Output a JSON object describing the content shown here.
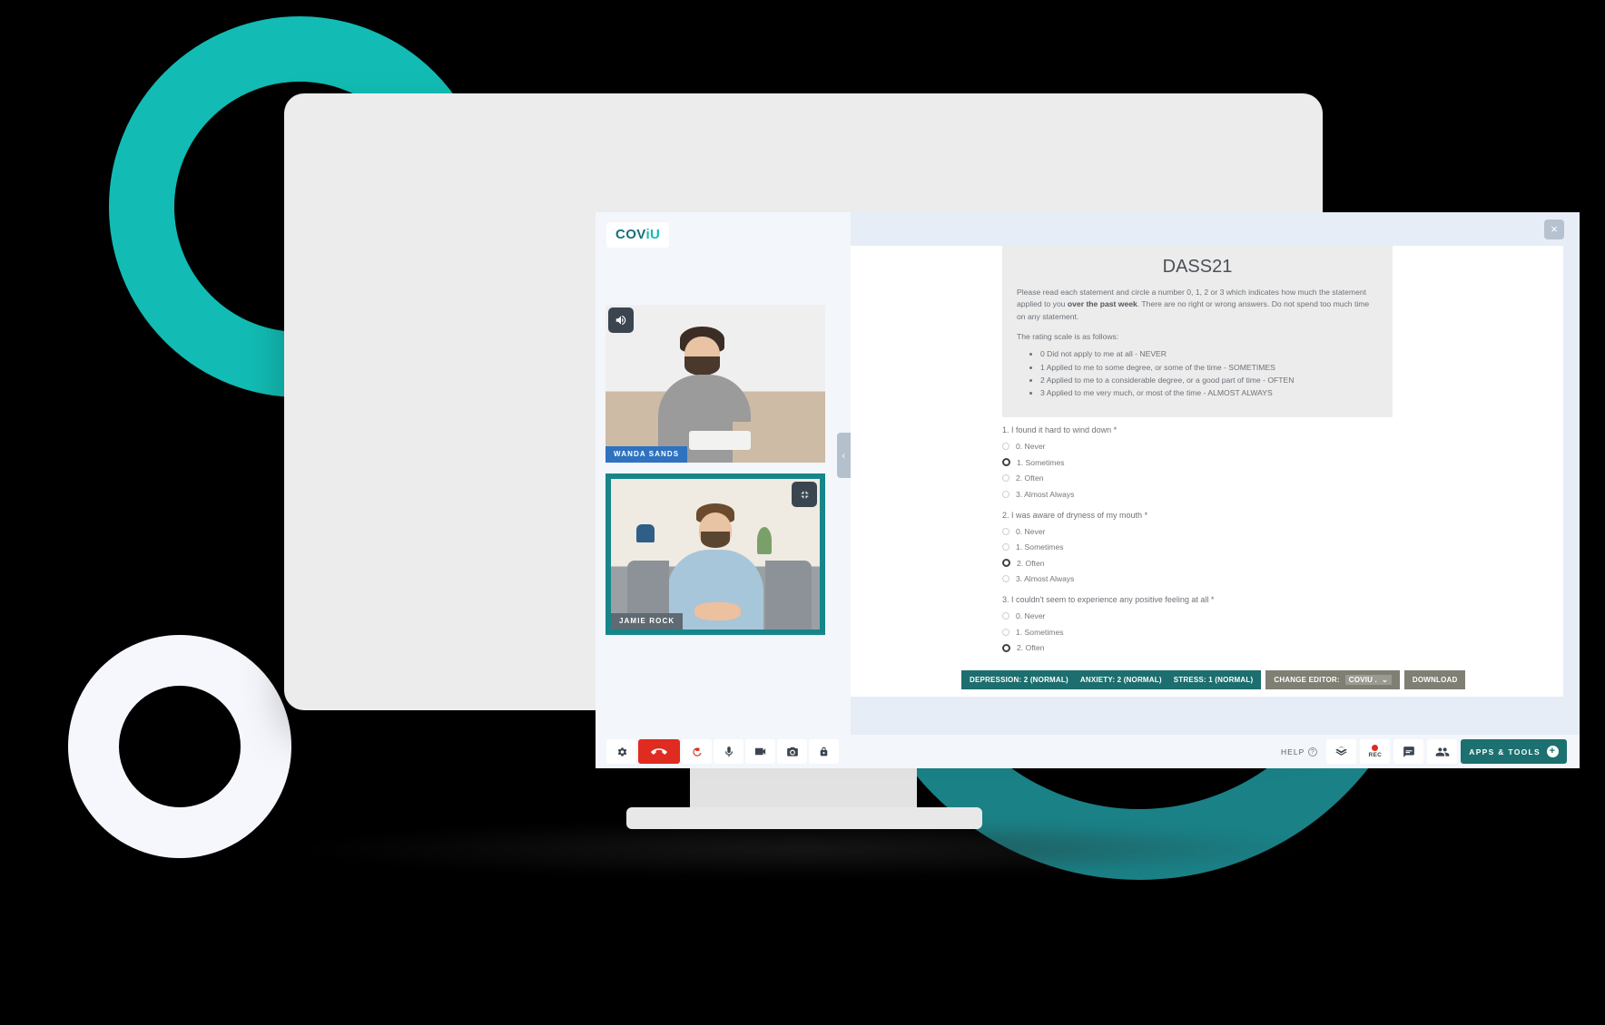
{
  "brand": {
    "logo_part_a": "COV",
    "logo_part_b": "iU",
    "accent_teal": "#1d7070",
    "accent_light_teal": "#12bcb4",
    "accent_dark_teal": "#1a8186",
    "danger_red": "#e02b20"
  },
  "video": {
    "tiles": [
      {
        "name": "WANDA SANDS",
        "icon": "speaker-icon"
      },
      {
        "name": "JAMIE ROCK",
        "icon": "shrink-icon"
      }
    ],
    "collapse_left": "‹",
    "collapse_right": "›"
  },
  "panel": {
    "close_label": "×"
  },
  "form": {
    "title": "DASS21",
    "intro_part1": "Please read each statement and circle a number 0, 1, 2 or 3 which indicates how much the statement applied to you ",
    "intro_bold": "over the past week",
    "intro_part2": ". There are no right or wrong answers. Do not spend too much time on any statement.",
    "scale_header": "The rating scale is as follows:",
    "scale_items": [
      "0 Did not apply to me at all - NEVER",
      "1 Applied to me to some degree, or some of the time - SOMETIMES",
      "2 Applied to me to a considerable degree, or a good part of time - OFTEN",
      "3 Applied to me very much, or most of the time - ALMOST ALWAYS"
    ],
    "questions": [
      {
        "text": "1. I found it hard to wind down *",
        "options": [
          "0. Never",
          "1. Sometimes",
          "2. Often",
          "3. Almost Always"
        ],
        "selected": 1
      },
      {
        "text": "2. I was aware of dryness of my mouth *",
        "options": [
          "0. Never",
          "1. Sometimes",
          "2. Often",
          "3. Almost Always"
        ],
        "selected": 2
      },
      {
        "text": "3. I couldn't seem to experience any positive feeling at all *",
        "options": [
          "0. Never",
          "1. Sometimes",
          "2. Often"
        ],
        "selected": 2
      }
    ]
  },
  "results": {
    "depression": "DEPRESSION: 2 (NORMAL)",
    "anxiety": "ANXIETY: 2 (NORMAL)",
    "stress": "STRESS: 1 (NORMAL)",
    "change_editor_label": "CHANGE EDITOR:",
    "change_editor_value": "COVIU .",
    "change_editor_caret": "⌄",
    "download_label": "DOWNLOAD"
  },
  "controls": {
    "left": [
      {
        "name": "settings-button",
        "icon": "gear-icon"
      },
      {
        "name": "hangup-button",
        "icon": "phone-hangup-icon"
      },
      {
        "name": "refresh-button",
        "icon": "refresh-icon"
      },
      {
        "name": "microphone-button",
        "icon": "microphone-icon"
      },
      {
        "name": "camera-button",
        "icon": "video-camera-icon"
      },
      {
        "name": "snapshot-button",
        "icon": "photo-camera-icon"
      },
      {
        "name": "lock-button",
        "icon": "lock-icon"
      }
    ],
    "help_label": "HELP",
    "help_marker": "?",
    "layers_icon": "layers-icon",
    "rec_label": "REC",
    "chat_icon": "chat-icon",
    "participants_icon": "participants-icon",
    "apps_tools_label": "APPS & TOOLS",
    "apps_tools_plus": "+"
  }
}
